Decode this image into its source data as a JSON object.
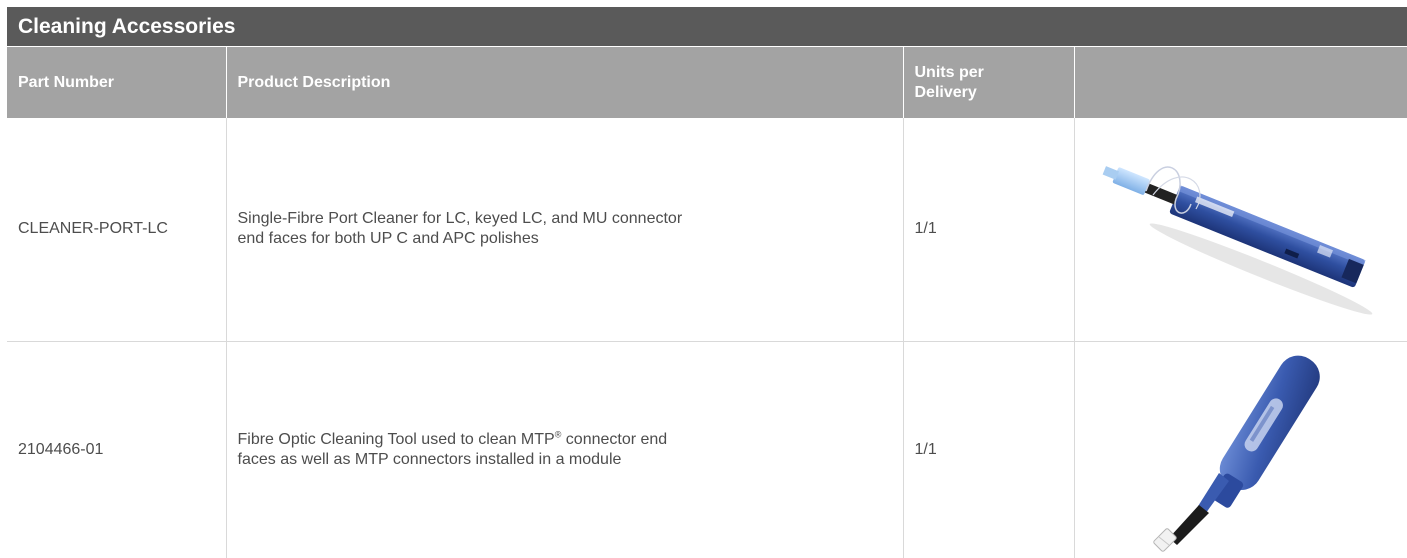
{
  "table": {
    "title": "Cleaning Accessories",
    "headers": {
      "part_number": "Part Number",
      "product_description": "Product Description",
      "units_per_delivery_line1": "Units per",
      "units_per_delivery_line2": "Delivery",
      "image": ""
    },
    "rows": [
      {
        "part_number": "CLEANER-PORT-LC",
        "description_line1": "Single-Fibre Port Cleaner for LC, keyed LC, and MU connector",
        "description_line2": "end faces for both UP C and APC polishes",
        "units": "1/1",
        "image_icon": "port-cleaner-pen-icon"
      },
      {
        "part_number": "2104466-01",
        "description_pre": "Fibre Optic Cleaning Tool used to clean MTP",
        "description_reg": "®",
        "description_post": " connector end",
        "description_line2": "faces as well as MTP connectors installed in a module",
        "units": "1/1",
        "image_icon": "mtp-cleaning-tool-icon"
      }
    ]
  },
  "colors": {
    "title_bg": "#5a5a5a",
    "header_bg": "#a3a3a3",
    "text": "#4d4d4d",
    "grid_line": "#d9d9d9",
    "product_blue": "#2f4fa0"
  }
}
